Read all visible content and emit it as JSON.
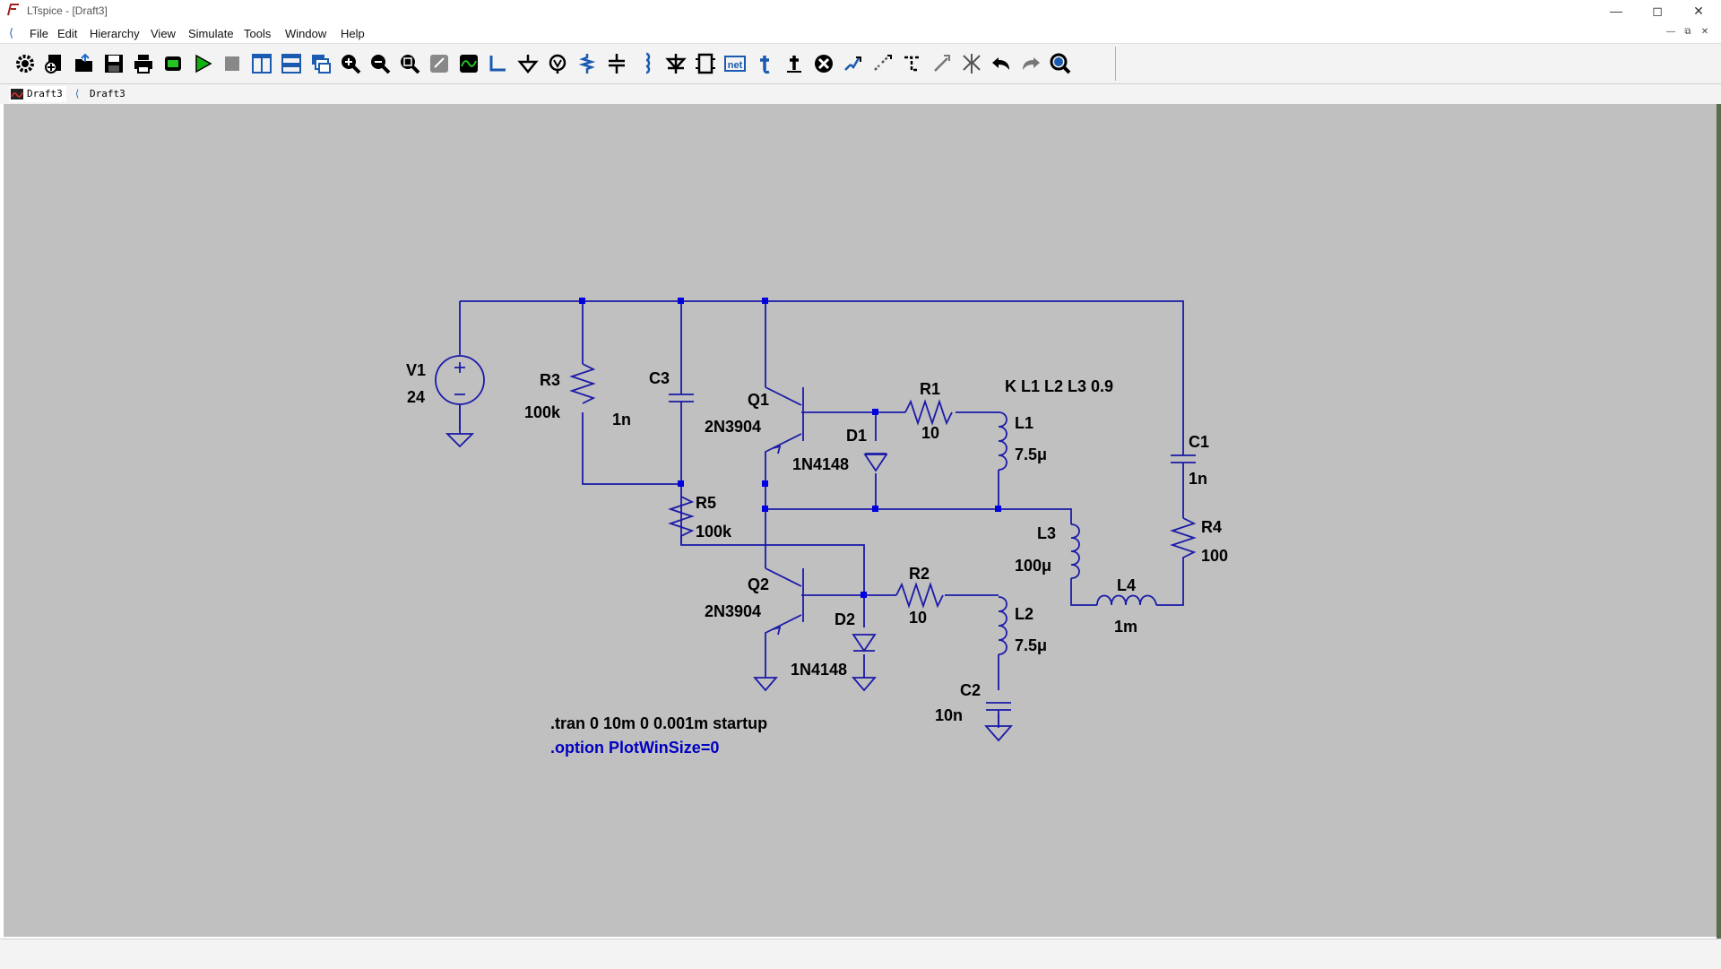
{
  "window": {
    "title": "LTspice - [Draft3]"
  },
  "menu": [
    "File",
    "Edit",
    "Hierarchy",
    "View",
    "Simulate",
    "Tools",
    "Window",
    "Help"
  ],
  "toolbar_icons": [
    "settings-icon",
    "new-schematic-icon",
    "open-icon",
    "save-icon",
    "print-icon",
    "control-panel-icon",
    "run-icon",
    "halt-icon",
    "tile-vertical-icon",
    "tile-horizontal-icon",
    "cascade-icon",
    "zoom-in-icon",
    "zoom-out-icon",
    "zoom-fit-icon",
    "zoom-back-icon",
    "autorange-icon",
    "wire-icon",
    "ground-icon",
    "label-net-icon",
    "resistor-icon",
    "capacitor-icon",
    "inductor-icon",
    "diode-icon",
    "component-icon",
    "net-name-icon",
    "spice-directive-icon",
    "text-icon",
    "delete-icon",
    "duplicate-icon",
    "move-icon",
    "drag-icon",
    "rotate-icon",
    "mirror-icon",
    "undo-icon",
    "redo-icon",
    "find-icon"
  ],
  "tabs": [
    {
      "label": "Draft3",
      "icon": "waveform-icon"
    },
    {
      "label": "Draft3",
      "icon": "schematic-icon"
    }
  ],
  "schematic": {
    "components": [
      {
        "id": "V1",
        "value": "24"
      },
      {
        "id": "R3",
        "value": "100k"
      },
      {
        "id": "C3",
        "value": "1n"
      },
      {
        "id": "Q1",
        "value": "2N3904"
      },
      {
        "id": "D1",
        "value": "1N4148"
      },
      {
        "id": "R1",
        "value": "10"
      },
      {
        "id": "L1",
        "value": "7.5μ"
      },
      {
        "id": "C1",
        "value": "1n"
      },
      {
        "id": "R5",
        "value": "100k"
      },
      {
        "id": "L3",
        "value": "100μ"
      },
      {
        "id": "R4",
        "value": "100"
      },
      {
        "id": "Q2",
        "value": "2N3904"
      },
      {
        "id": "R2",
        "value": "10"
      },
      {
        "id": "L2",
        "value": "7.5μ"
      },
      {
        "id": "L4",
        "value": "1m"
      },
      {
        "id": "D2",
        "value": "1N4148"
      },
      {
        "id": "C2",
        "value": "10n"
      }
    ],
    "coupling": "K L1 L2 L3 0.9",
    "directives": [
      ".tran 0 10m 0 0.001m startup",
      ".option PlotWinSize=0"
    ],
    "colors": {
      "wire": "#1a1aa8",
      "junction": "#0000e0",
      "background": "#c0c0c0",
      "directive_option": "#0000c0"
    }
  }
}
